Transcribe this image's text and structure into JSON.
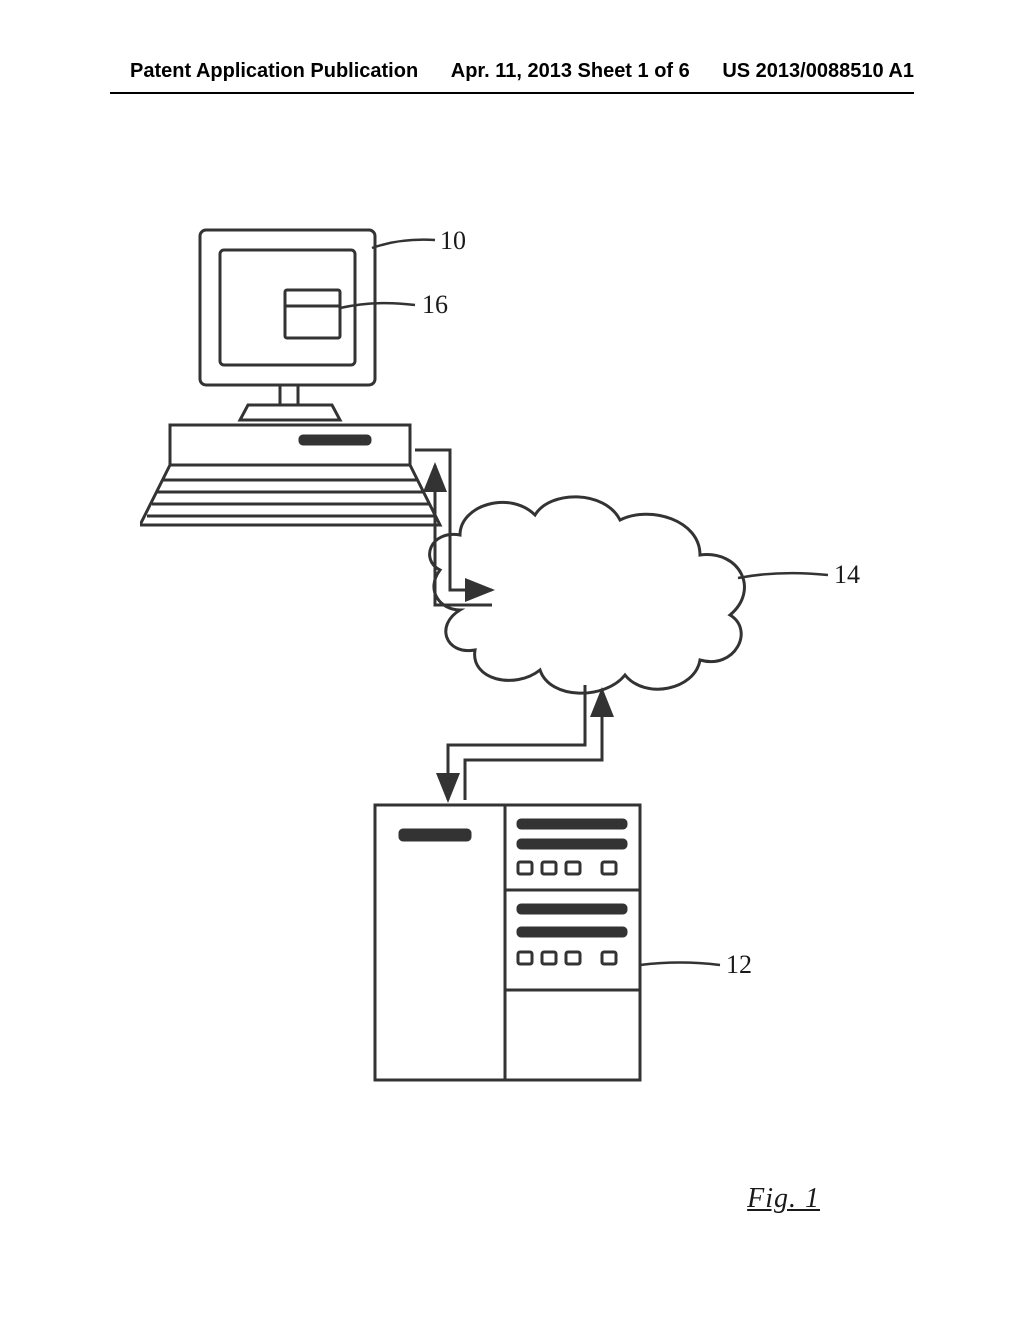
{
  "header": {
    "left": "Patent Application Publication",
    "center": "Apr. 11, 2013  Sheet 1 of 6",
    "right": "US 2013/0088510 A1"
  },
  "figure": {
    "label": "Fig. 1",
    "annotations": {
      "computer": "10",
      "display_window": "16",
      "cloud": "14",
      "server": "12"
    }
  }
}
